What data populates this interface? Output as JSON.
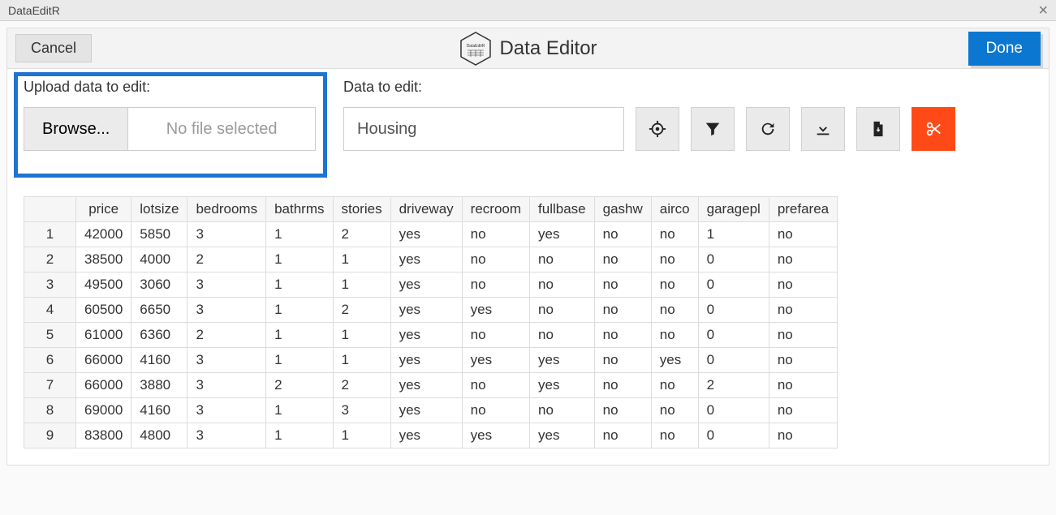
{
  "window": {
    "title": "DataEditR"
  },
  "header": {
    "cancel": "Cancel",
    "title": "Data Editor",
    "logo_text": "DataEditR",
    "done": "Done"
  },
  "upload": {
    "label": "Upload data to edit:",
    "browse": "Browse...",
    "placeholder": "No file selected"
  },
  "data_select": {
    "label": "Data to edit:",
    "value": "Housing"
  },
  "toolbar_icons": [
    "target",
    "filter",
    "refresh",
    "download",
    "file",
    "cut"
  ],
  "table": {
    "columns": [
      "price",
      "lotsize",
      "bedrooms",
      "bathrms",
      "stories",
      "driveway",
      "recroom",
      "fullbase",
      "gashw",
      "airco",
      "garagepl",
      "prefarea"
    ],
    "rows": [
      {
        "n": "1",
        "price": "42000",
        "lotsize": "5850",
        "bedrooms": "3",
        "bathrms": "1",
        "stories": "2",
        "driveway": "yes",
        "recroom": "no",
        "fullbase": "yes",
        "gashw": "no",
        "airco": "no",
        "garagepl": "1",
        "prefarea": "no"
      },
      {
        "n": "2",
        "price": "38500",
        "lotsize": "4000",
        "bedrooms": "2",
        "bathrms": "1",
        "stories": "1",
        "driveway": "yes",
        "recroom": "no",
        "fullbase": "no",
        "gashw": "no",
        "airco": "no",
        "garagepl": "0",
        "prefarea": "no"
      },
      {
        "n": "3",
        "price": "49500",
        "lotsize": "3060",
        "bedrooms": "3",
        "bathrms": "1",
        "stories": "1",
        "driveway": "yes",
        "recroom": "no",
        "fullbase": "no",
        "gashw": "no",
        "airco": "no",
        "garagepl": "0",
        "prefarea": "no"
      },
      {
        "n": "4",
        "price": "60500",
        "lotsize": "6650",
        "bedrooms": "3",
        "bathrms": "1",
        "stories": "2",
        "driveway": "yes",
        "recroom": "yes",
        "fullbase": "no",
        "gashw": "no",
        "airco": "no",
        "garagepl": "0",
        "prefarea": "no"
      },
      {
        "n": "5",
        "price": "61000",
        "lotsize": "6360",
        "bedrooms": "2",
        "bathrms": "1",
        "stories": "1",
        "driveway": "yes",
        "recroom": "no",
        "fullbase": "no",
        "gashw": "no",
        "airco": "no",
        "garagepl": "0",
        "prefarea": "no"
      },
      {
        "n": "6",
        "price": "66000",
        "lotsize": "4160",
        "bedrooms": "3",
        "bathrms": "1",
        "stories": "1",
        "driveway": "yes",
        "recroom": "yes",
        "fullbase": "yes",
        "gashw": "no",
        "airco": "yes",
        "garagepl": "0",
        "prefarea": "no"
      },
      {
        "n": "7",
        "price": "66000",
        "lotsize": "3880",
        "bedrooms": "3",
        "bathrms": "2",
        "stories": "2",
        "driveway": "yes",
        "recroom": "no",
        "fullbase": "yes",
        "gashw": "no",
        "airco": "no",
        "garagepl": "2",
        "prefarea": "no"
      },
      {
        "n": "8",
        "price": "69000",
        "lotsize": "4160",
        "bedrooms": "3",
        "bathrms": "1",
        "stories": "3",
        "driveway": "yes",
        "recroom": "no",
        "fullbase": "no",
        "gashw": "no",
        "airco": "no",
        "garagepl": "0",
        "prefarea": "no"
      },
      {
        "n": "9",
        "price": "83800",
        "lotsize": "4800",
        "bedrooms": "3",
        "bathrms": "1",
        "stories": "1",
        "driveway": "yes",
        "recroom": "yes",
        "fullbase": "yes",
        "gashw": "no",
        "airco": "no",
        "garagepl": "0",
        "prefarea": "no"
      }
    ]
  }
}
